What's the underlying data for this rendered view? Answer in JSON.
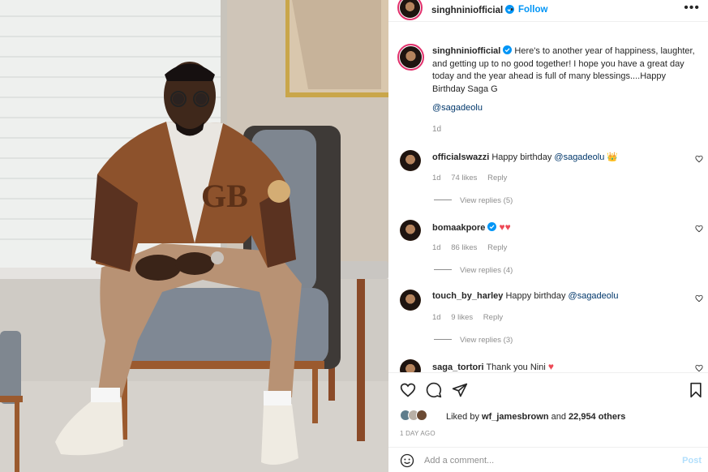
{
  "post": {
    "author": "singhniniofficial",
    "follow_label": "Follow",
    "separator": "•",
    "more_label": "•••",
    "caption": "Here's to another year of happiness, laughter, and getting up to no good together! I hope you have a great day today and the year ahead is full of many blessings....Happy Birthday Saga G",
    "caption_mention": "@sagadeolu",
    "caption_time": "1d"
  },
  "comments": [
    {
      "user": "officialswazzi",
      "text": "Happy birthday ",
      "mention": "@sagadeolu",
      "emoji": "👑",
      "time": "1d",
      "likes": "74 likes",
      "reply": "Reply",
      "view_replies": "View replies (5)",
      "verified": false
    },
    {
      "user": "bomaakpore",
      "text": "",
      "mention": "",
      "emoji": "♥♥",
      "time": "1d",
      "likes": "86 likes",
      "reply": "Reply",
      "view_replies": "View replies (4)",
      "verified": true
    },
    {
      "user": "touch_by_harley",
      "text": "Happy birthday ",
      "mention": "@sagadeolu",
      "emoji": "",
      "time": "1d",
      "likes": "9 likes",
      "reply": "Reply",
      "view_replies": "View replies (3)",
      "verified": false
    },
    {
      "user": "saga_tortori",
      "text": "Thank you Nini ",
      "mention": "",
      "emoji": "♥",
      "time": "",
      "likes": "",
      "reply": "",
      "view_replies": "",
      "verified": false
    }
  ],
  "footer": {
    "liked_by_prefix": "Liked by ",
    "liked_by_user": "wf_jamesbrown",
    "liked_by_suffix": " and ",
    "liked_by_count": "22,954 others",
    "post_time": "1 DAY AGO",
    "comment_placeholder": "Add a comment...",
    "post_label": "Post"
  },
  "icons": {
    "like": "heart-outline-icon",
    "comment": "comment-bubble-icon",
    "share": "paper-plane-icon",
    "save": "bookmark-icon",
    "emoji": "smiley-icon",
    "verified": "verified-badge-icon"
  },
  "colors": {
    "link": "#0095f6",
    "mention": "#00376b",
    "muted": "#8e8e8e",
    "heart": "#ed4956",
    "story_ring": "#e1306c"
  }
}
